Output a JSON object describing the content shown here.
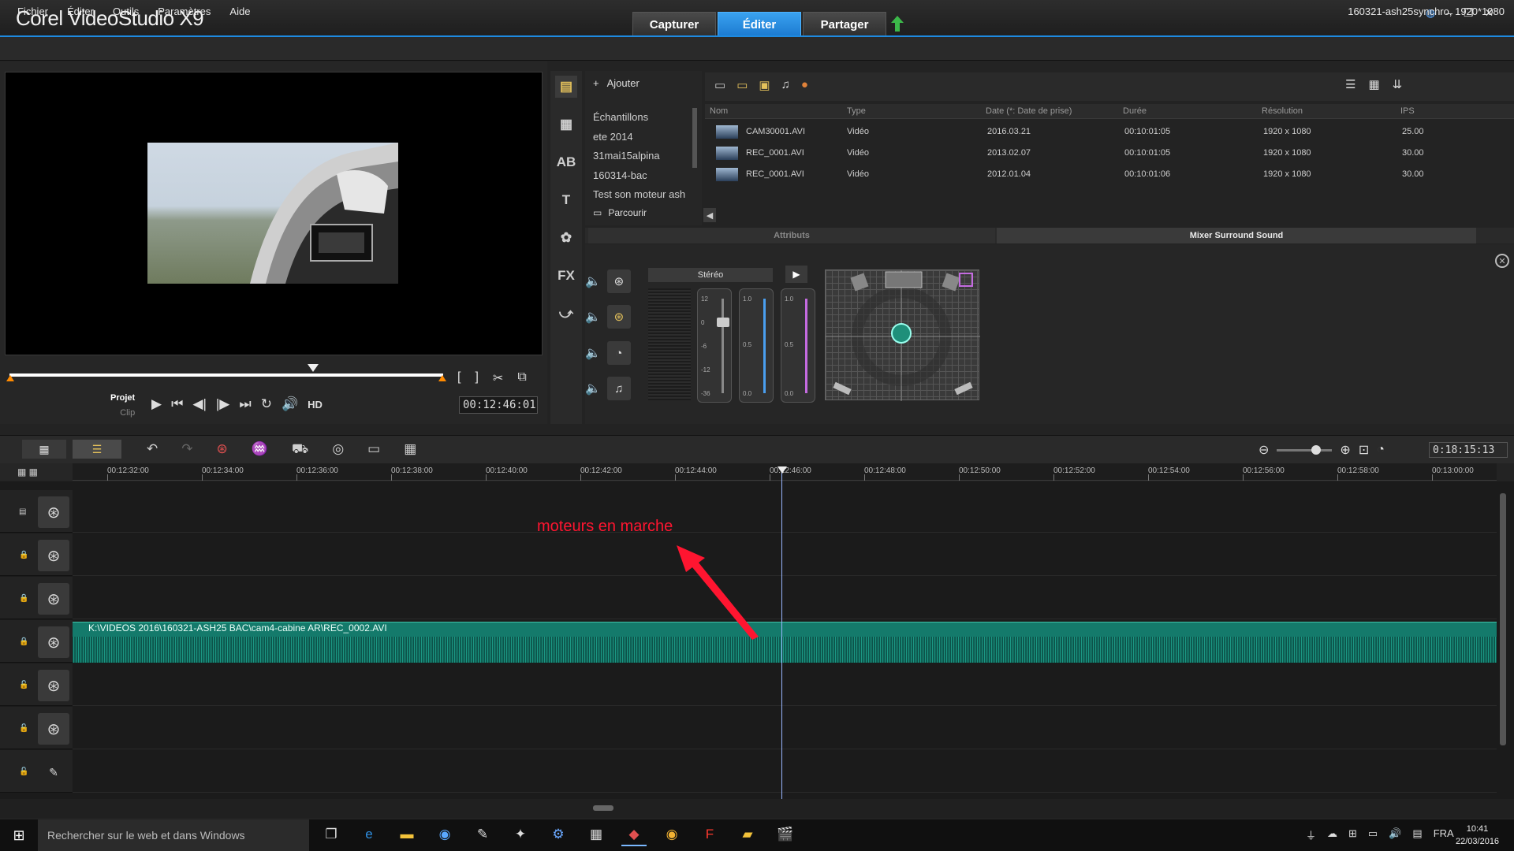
{
  "titlebar": {
    "app_title": "Corel VideoStudio X9",
    "mode_tabs": [
      {
        "label": "Capturer",
        "active": false
      },
      {
        "label": "Éditer",
        "active": true
      },
      {
        "label": "Partager",
        "active": false
      }
    ],
    "window_controls": [
      "globe-icon",
      "minimize-icon",
      "restore-icon",
      "close-icon"
    ]
  },
  "menubar": {
    "items": [
      "Fichier",
      "Éditer",
      "Outils",
      "Paramètres",
      "Aide"
    ],
    "project_info": "160321-ash25synchro, 1920*1080"
  },
  "player": {
    "mode_project": "Projet",
    "mode_clip": "Clip",
    "hd_label": "HD",
    "timecode": "00:12:46:01",
    "trim_buttons": [
      "[",
      "]",
      "✂",
      "⧉"
    ],
    "transport": [
      "▶",
      "⏮",
      "◀|",
      "|▶",
      "⏭",
      "↻",
      "🔊"
    ]
  },
  "library": {
    "add_label": "Ajouter",
    "browse_label": "Parcourir",
    "folders": [
      "Échantillons",
      "ete 2014",
      "31mai15alpina",
      "160314-bac",
      "Test son moteur ash"
    ],
    "columns": [
      "Nom",
      "Type",
      "Date (*: Date de prise)",
      "Durée",
      "Résolution",
      "IPS"
    ],
    "files": [
      {
        "name": "CAM30001.AVI",
        "type": "Vidéo",
        "date": "2016.03.21",
        "duration": "00:10:01:05",
        "resolution": "1920 x 1080",
        "fps": "25.00"
      },
      {
        "name": "REC_0001.AVI",
        "type": "Vidéo",
        "date": "2013.02.07",
        "duration": "00:10:01:05",
        "resolution": "1920 x 1080",
        "fps": "30.00"
      },
      {
        "name": "REC_0001.AVI",
        "type": "Vidéo",
        "date": "2012.01.04",
        "duration": "00:10:01:06",
        "resolution": "1920 x 1080",
        "fps": "30.00"
      }
    ]
  },
  "panels": {
    "attributes_tab": "Attributs",
    "mixer_tab": "Mixer Surround Sound",
    "stereo_label": "Stéréo",
    "fader_scale_1": [
      "12",
      "0",
      "-6",
      "-12",
      "-36"
    ],
    "fader_scale_2": [
      "1.0",
      "0.5",
      "0.0"
    ],
    "fader_scale_3": [
      "1.0",
      "0.5",
      "0.0"
    ]
  },
  "timeline": {
    "project_duration": "0:18:15:13",
    "ruler_ticks": [
      "00:12:32:00",
      "00:12:34:00",
      "00:12:36:00",
      "00:12:38:00",
      "00:12:40:00",
      "00:12:42:00",
      "00:12:44:00",
      "00:12:46:00",
      "00:12:48:00",
      "00:12:50:00",
      "00:12:52:00",
      "00:12:54:00",
      "00:12:56:00",
      "00:12:58:00",
      "00:13:00:00"
    ],
    "audio_clip_label": "K:\\VIDEOS 2016\\160321-ASH25 BAC\\cam4-cabine AR\\REC_0002.AVI",
    "annotation": "moteurs en marche"
  },
  "taskbar": {
    "search_placeholder": "Rechercher sur le web et dans Windows",
    "language": "FRA",
    "time": "10:41",
    "date": "22/03/2016"
  },
  "colors": {
    "accent": "#1e8ae0",
    "audio_clip": "#147a6b",
    "annotation": "#ff1530"
  }
}
